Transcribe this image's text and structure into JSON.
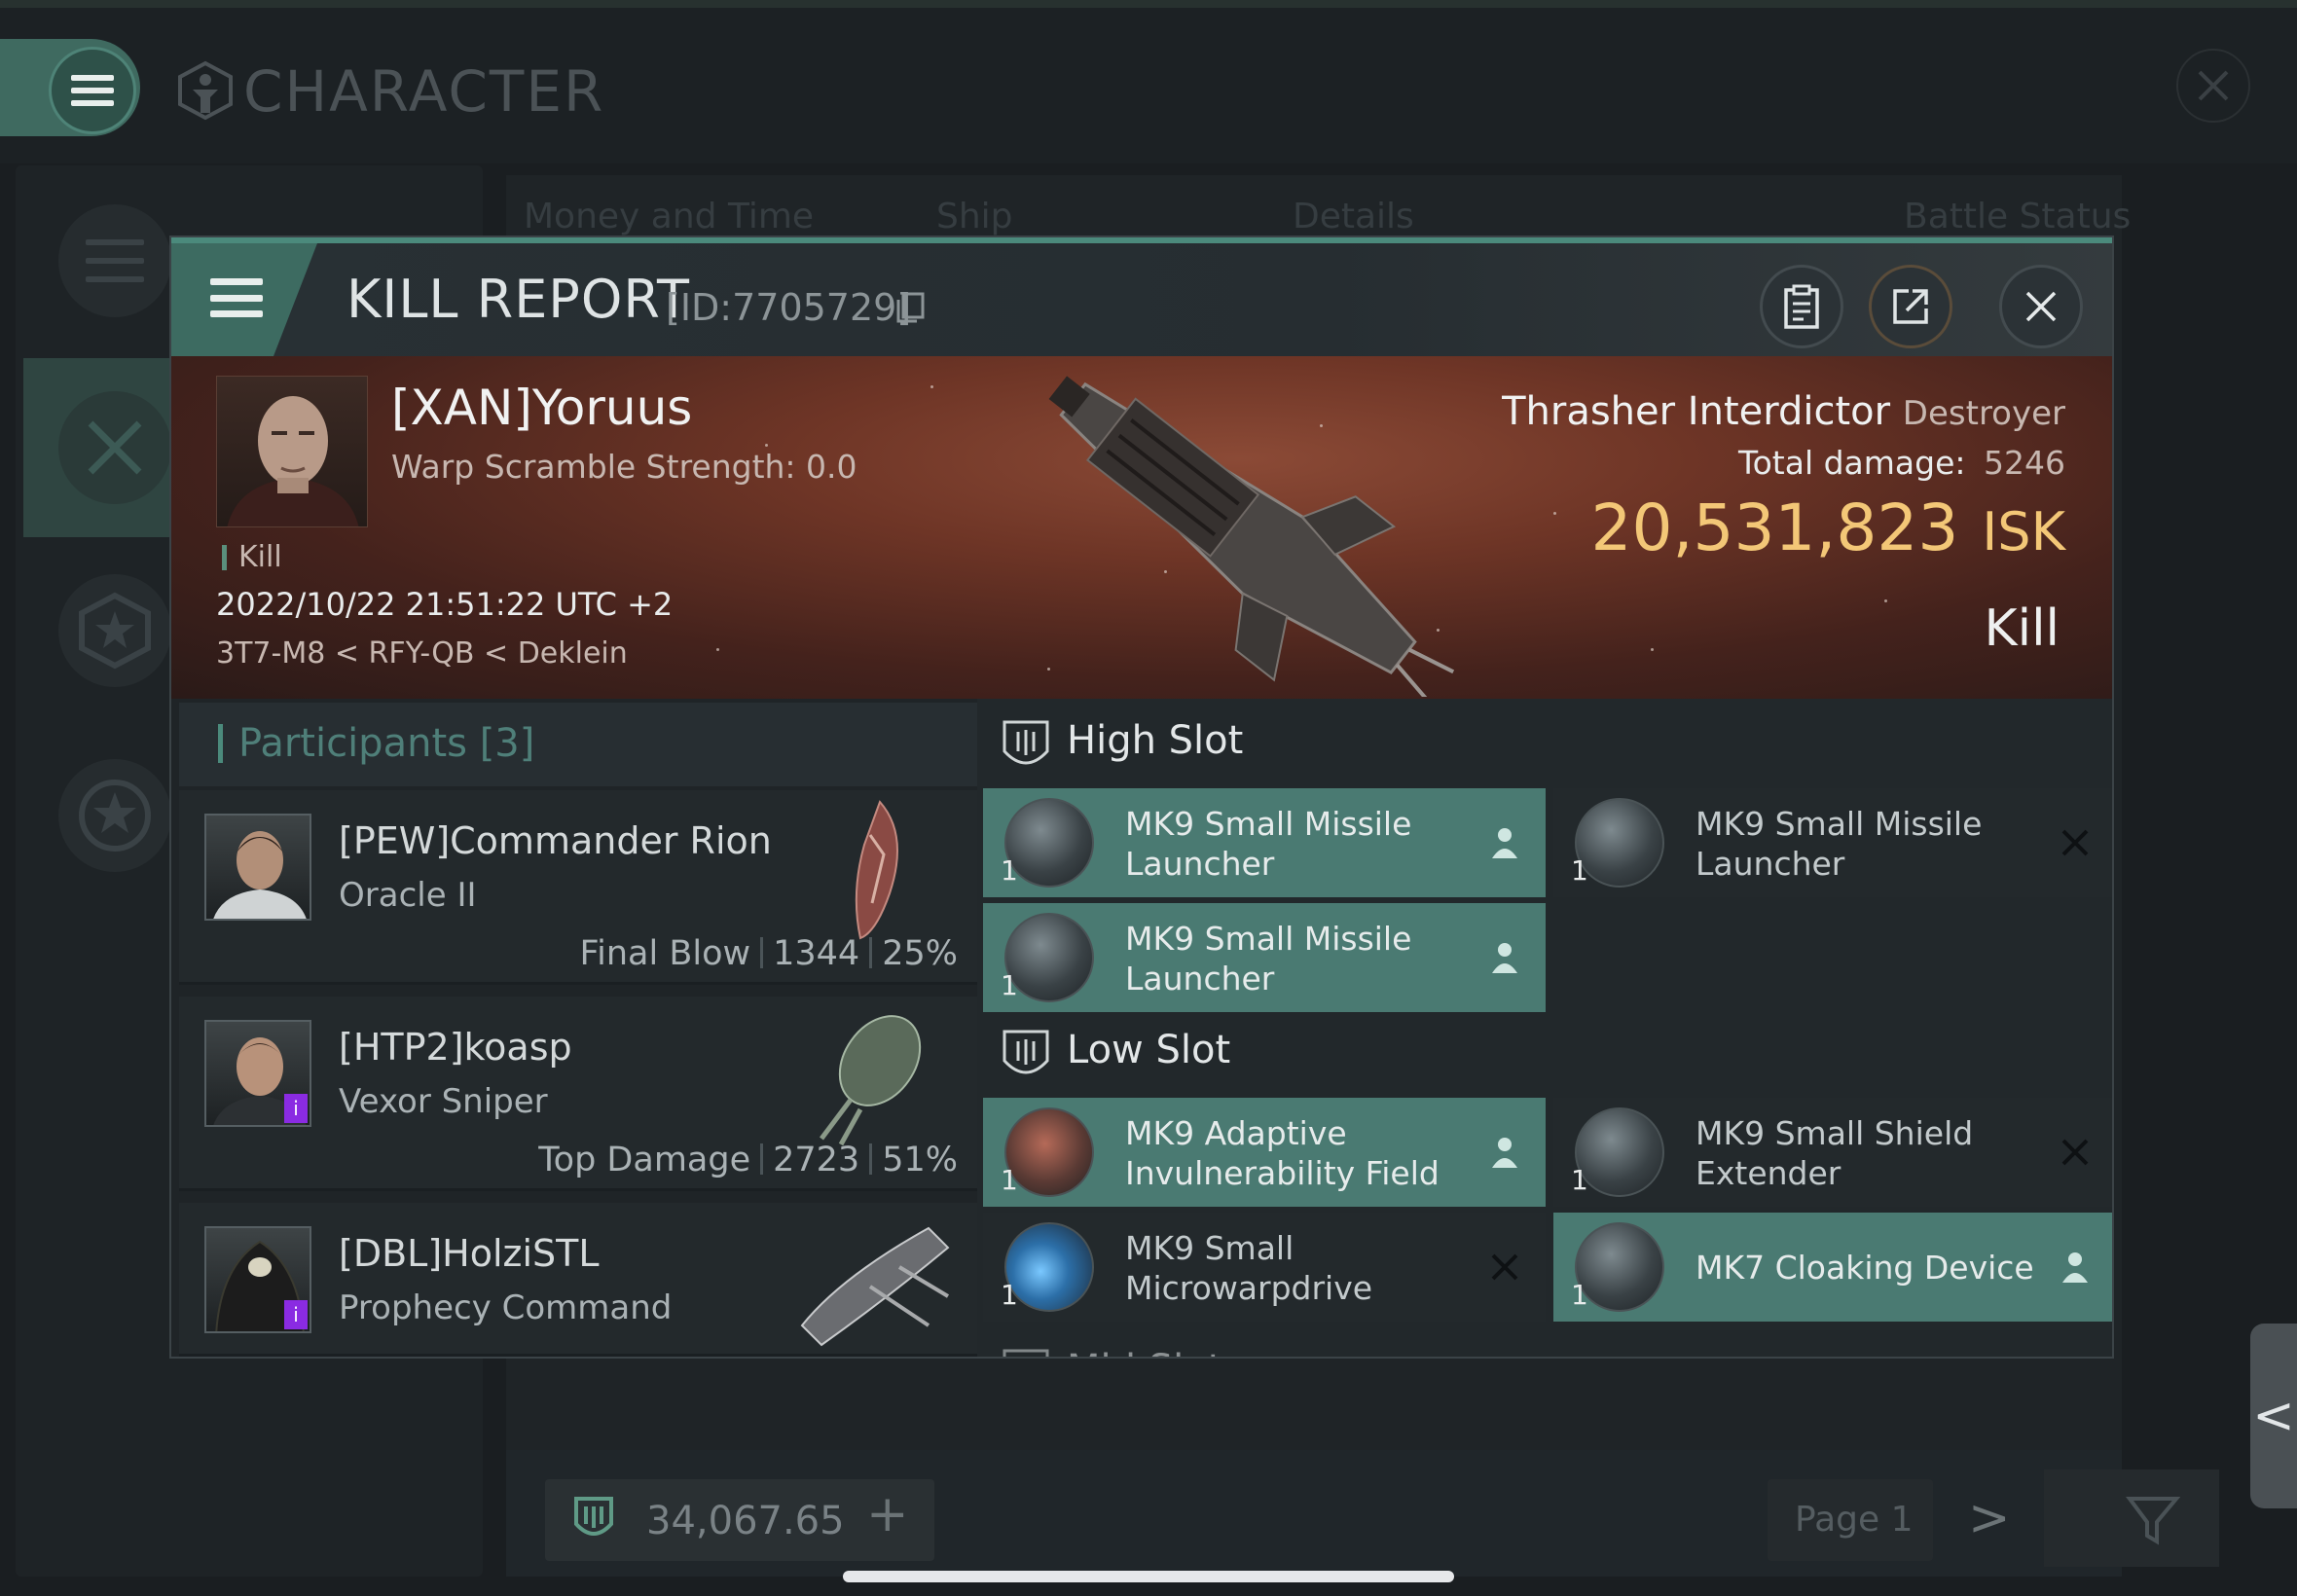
{
  "app": {
    "title": "CHARACTER",
    "bg_tabs": [
      "Money and Time",
      "Ship",
      "Details",
      "Battle Status"
    ],
    "wallet_value": "34,067.65",
    "wallet_add": "+",
    "page_label": "Page 1",
    "page_next": ">",
    "side_handle": "<"
  },
  "report": {
    "title": "KILL REPORT",
    "id": "[ID:7705729]",
    "victim": {
      "name": "[XAN]Yoruus",
      "subtitle": "Warp Scramble Strength: 0.0",
      "tag": "Kill",
      "datetime": "2022/10/22 21:51:22 UTC +2",
      "location": "3T7-M8 < RFY-QB < Deklein"
    },
    "ship": {
      "name": "Thrasher Interdictor",
      "class": "Destroyer",
      "damage_label": "Total damage:",
      "damage_value": "5246",
      "isk_value": "20,531,823",
      "isk_unit": "ISK",
      "result": "Kill"
    },
    "participants": {
      "title": "Participants",
      "count": "[3]",
      "rows": [
        {
          "name": "[PEW]Commander Rion",
          "ship": "Oracle II",
          "role": "Final Blow",
          "damage": "1344",
          "percent": "25%"
        },
        {
          "name": "[HTP2]koasp",
          "ship": "Vexor Sniper",
          "role": "Top Damage",
          "damage": "2723",
          "percent": "51%"
        },
        {
          "name": "[DBL]HolziSTL",
          "ship": "Prophecy Command",
          "role": "",
          "damage": "",
          "percent": ""
        }
      ]
    },
    "slots": {
      "high_title": "High Slot",
      "low_title": "Low Slot",
      "mid_title": "Mid Slot",
      "high": [
        {
          "name": "MK9 Small Missile Launcher",
          "qty": "1",
          "status": "dropped"
        },
        {
          "name": "MK9 Small Missile Launcher",
          "qty": "1",
          "status": "destroyed"
        },
        {
          "name": "MK9 Small Missile Launcher",
          "qty": "1",
          "status": "dropped"
        }
      ],
      "low": [
        {
          "name": "MK9 Adaptive Invulnerability Field",
          "qty": "1",
          "status": "dropped"
        },
        {
          "name": "MK9 Small Shield Extender",
          "qty": "1",
          "status": "destroyed"
        },
        {
          "name": "MK9 Small Microwarpdrive",
          "qty": "1",
          "status": "destroyed"
        },
        {
          "name": "MK7 Cloaking Device",
          "qty": "1",
          "status": "dropped"
        }
      ]
    }
  }
}
